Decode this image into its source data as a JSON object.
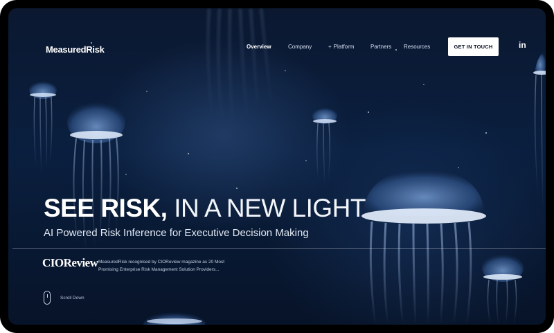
{
  "brand": {
    "logo": "MeasuredRisk"
  },
  "nav": {
    "items": [
      {
        "label": "Overview",
        "active": true
      },
      {
        "label": "Company",
        "active": false
      },
      {
        "label": "Platform",
        "active": false,
        "prefix": "+"
      },
      {
        "label": "Partners",
        "active": false
      },
      {
        "label": "Resources",
        "active": false
      }
    ],
    "cta_label": "GET IN TOUCH",
    "social_icon": "linkedin-icon",
    "social_text": "in"
  },
  "hero": {
    "headline_bold": "SEE RISK,",
    "headline_light": " IN A NEW LIGHT",
    "subheadline": "AI Powered Risk Inference for Executive Decision Making"
  },
  "press": {
    "logo": "CIOReview",
    "text": "MeasuredRisk recognised by CIOReview magazine as 20 Most Promising Enterprise Risk Management Solution Providers..."
  },
  "scroll": {
    "label": "Scroll Down",
    "icon": "mouse-icon"
  },
  "colors": {
    "background": "#0a1f3f",
    "accent_glow": "#cfe4ff",
    "cta_bg": "#ffffff"
  }
}
